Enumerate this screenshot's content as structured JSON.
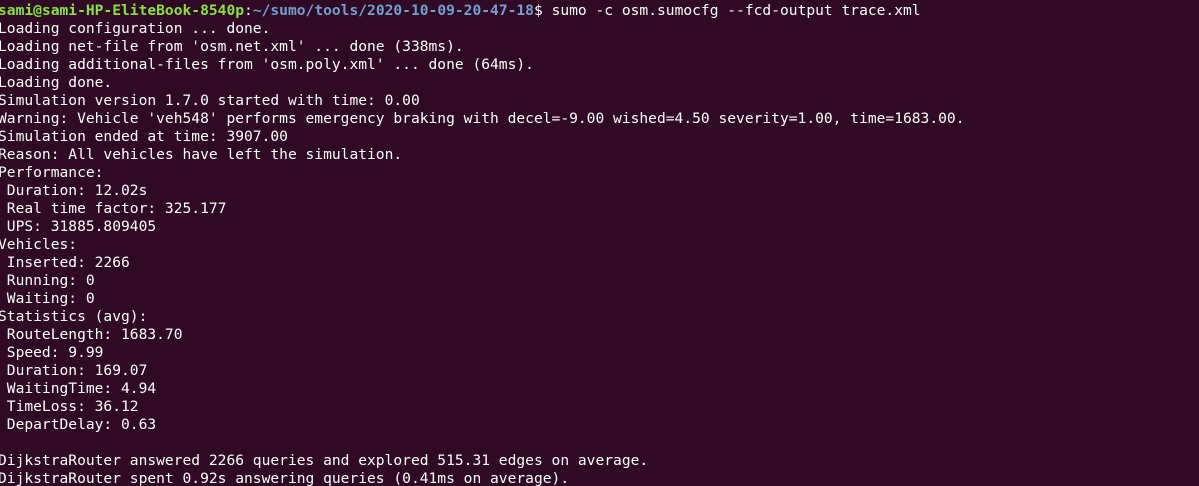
{
  "terminal": {
    "background": "#300a24",
    "prompt": {
      "user_host": "sami@sami-HP-EliteBook-8540p",
      "separator": ":",
      "path": "~/sumo/tools/2020-10-09-20-47-18",
      "symbol": "$ ",
      "command": "sumo -c osm.sumocfg --fcd-output trace.xml",
      "user_color": "#8ae234",
      "path_color": "#729fcf"
    },
    "output_lines": [
      "Loading configuration ... done.",
      "Loading net-file from 'osm.net.xml' ... done (338ms).",
      "Loading additional-files from 'osm.poly.xml' ... done (64ms).",
      "Loading done.",
      "Simulation version 1.7.0 started with time: 0.00",
      "Warning: Vehicle 'veh548' performs emergency braking with decel=-9.00 wished=4.50 severity=1.00, time=1683.00.",
      "Simulation ended at time: 3907.00",
      "Reason: All vehicles have left the simulation.",
      "Performance:",
      " Duration: 12.02s",
      " Real time factor: 325.177",
      " UPS: 31885.809405",
      "Vehicles:",
      " Inserted: 2266",
      " Running: 0",
      " Waiting: 0",
      "Statistics (avg):",
      " RouteLength: 1683.70",
      " Speed: 9.99",
      " Duration: 169.07",
      " WaitingTime: 4.94",
      " TimeLoss: 36.12",
      " DepartDelay: 0.63",
      "",
      "DijkstraRouter answered 2266 queries and explored 515.31 edges on average.",
      "DijkstraRouter spent 0.92s answering queries (0.41ms on average)."
    ]
  }
}
